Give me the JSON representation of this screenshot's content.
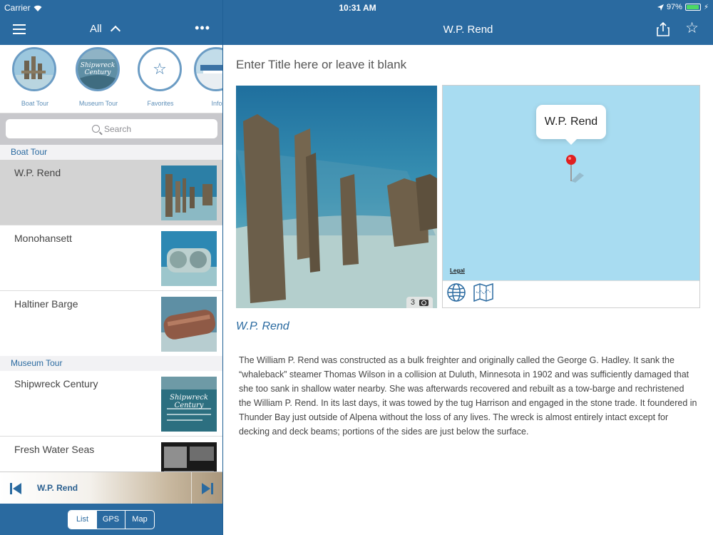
{
  "status_bar": {
    "carrier": "Carrier",
    "time": "10:31 AM",
    "battery": "97%"
  },
  "left_header": {
    "filter_label": "All",
    "more_label": "•••"
  },
  "tours": [
    {
      "label": "Boat Tour"
    },
    {
      "label": "Museum Tour"
    },
    {
      "label": "Favorites"
    },
    {
      "label": "Info"
    }
  ],
  "museum_cover_text": "Shipwreck Century",
  "search": {
    "placeholder": "Search"
  },
  "sections": {
    "boat_tour": "Boat Tour",
    "museum_tour": "Museum Tour"
  },
  "list": {
    "boat": [
      {
        "title": "W.P. Rend"
      },
      {
        "title": "Monohansett"
      },
      {
        "title": "Haltiner Barge"
      }
    ],
    "museum": [
      {
        "title": "Shipwreck Century"
      },
      {
        "title": "Fresh Water Seas"
      }
    ]
  },
  "player": {
    "title": "W.P. Rend"
  },
  "bottom_tabs": {
    "list": "List",
    "gps": "GPS",
    "map": "Map",
    "active": "List"
  },
  "detail": {
    "header_title": "W.P. Rend",
    "title_placeholder": "Enter Title here or leave it blank",
    "photo_count": "3",
    "map_callout": "W.P. Rend",
    "map_legal": "Legal",
    "subtitle": "W.P. Rend",
    "description": "The William P. Rend was constructed as a bulk freighter and originally called the George G. Hadley.  It sank the “whaleback” steamer Thomas Wilson in a collision at Duluth, Minnesota in 1902 and was sufficiently damaged that she too sank in shallow water nearby.  She was afterwards recovered and rebuilt as a tow-barge and rechristened the William P. Rend.   In its last days, it was towed by the tug Harrison and engaged in the stone trade.  It foundered in Thunder Bay just outside of Alpena without the loss of any lives.  The wreck is almost entirely intact except for decking and deck beams; portions of the sides are just below the surface."
  },
  "colors": {
    "brand": "#2a6aa0",
    "map_water": "#a8dcf1",
    "pin": "#e02020"
  }
}
